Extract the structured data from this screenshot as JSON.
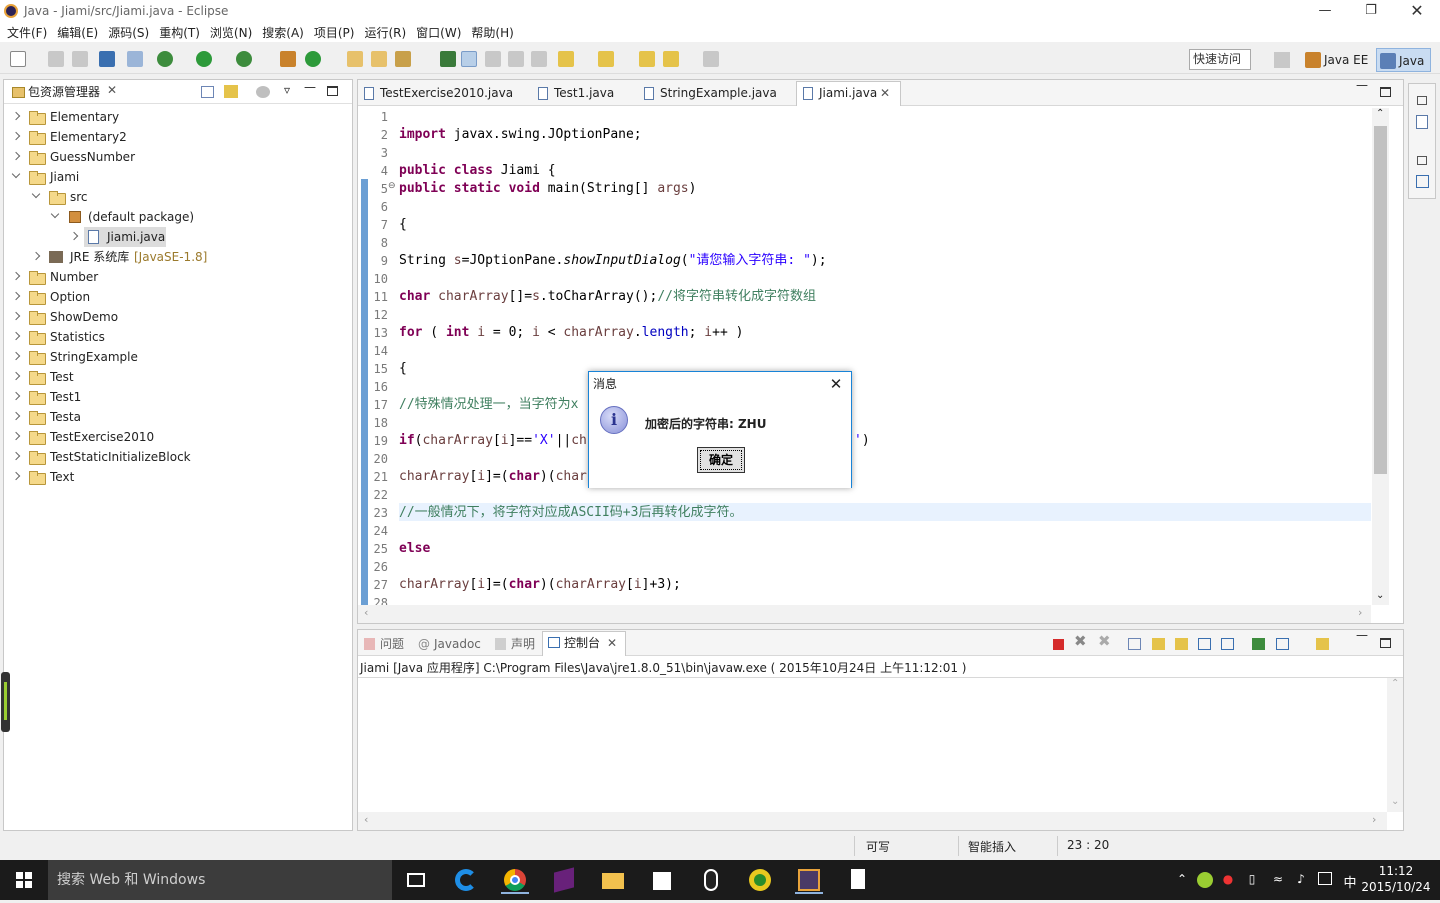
{
  "window": {
    "title": "Java  -  Jiami/src/Jiami.java  -  Eclipse"
  },
  "menu": [
    "文件(F)",
    "编辑(E)",
    "源码(S)",
    "重构(T)",
    "浏览(N)",
    "搜索(A)",
    "项目(P)",
    "运行(R)",
    "窗口(W)",
    "帮助(H)"
  ],
  "toolbar": {
    "quick_access": "快速访问"
  },
  "perspectives": [
    "Java EE",
    "Java"
  ],
  "package_explorer": {
    "title": "包资源管理器",
    "items": [
      {
        "label": "Elementary"
      },
      {
        "label": "Elementary2"
      },
      {
        "label": "GuessNumber"
      },
      {
        "label": "Jiami"
      },
      {
        "label": "src"
      },
      {
        "label": "(default package)"
      },
      {
        "label": "Jiami.java"
      },
      {
        "label": "JRE 系统库",
        "extra": "[JavaSE-1.8]"
      },
      {
        "label": "Number"
      },
      {
        "label": "Option"
      },
      {
        "label": "ShowDemo"
      },
      {
        "label": "Statistics"
      },
      {
        "label": "StringExample"
      },
      {
        "label": "Test"
      },
      {
        "label": "Test1"
      },
      {
        "label": "Testa"
      },
      {
        "label": "TestExercise2010"
      },
      {
        "label": "TestStaticInitializeBlock"
      },
      {
        "label": "Text"
      }
    ]
  },
  "editor": {
    "tabs": [
      "TestExercise2010.java",
      "Test1.java",
      "StringExample.java",
      "Jiami.java"
    ],
    "line_numbers": [
      "1",
      "2",
      "3",
      "4",
      "5",
      "6",
      "7",
      "8",
      "9",
      "10",
      "11",
      "12",
      "13",
      "14",
      "15",
      "16",
      "17",
      "18",
      "19",
      "20",
      "21",
      "22",
      "23",
      "24",
      "25",
      "26",
      "27",
      "28"
    ],
    "code": {
      "l2a": "import",
      "l2b": " javax.swing.JOptionPane;",
      "l4a": "public",
      "l4b": " ",
      "l4c": "class",
      "l4d": " Jiami {",
      "l5a": "public",
      "l5b": " ",
      "l5c": "static",
      "l5d": " ",
      "l5e": "void",
      "l5f": " main(String[] ",
      "l5g": "args",
      "l5h": ")",
      "l7": "{",
      "l9a": "String ",
      "l9b": "s",
      "l9c": "=JOptionPane.",
      "l9d": "showInputDialog",
      "l9e": "(",
      "l9f": "\"请您输入字符串: \"",
      "l9g": ");",
      "l11a": "char",
      "l11b": " ",
      "l11c": "charArray",
      "l11d": "[]=",
      "l11e": "s",
      "l11f": ".toCharArray();",
      "l11g": "//将字符串转化成字符数组",
      "l13a": "for",
      "l13b": " ( ",
      "l13c": "int",
      "l13d": " ",
      "l13e": "i",
      "l13f": " = 0; ",
      "l13g": "i",
      "l13h": " < ",
      "l13i": "charArray",
      "l13j": ".",
      "l13k": "length",
      "l13l": "; ",
      "l13m": "i",
      "l13n": "++ )",
      "l15": "{",
      "l17": "//特殊情况处理一，当字符为x",
      "l19a": "if",
      "l19b": "(",
      "l19c": "charArray",
      "l19d": "[",
      "l19e": "i",
      "l19f": "]==",
      "l19g": "'X'",
      "l19h": "||",
      "l19i": "ch",
      "l19z1": "'",
      "l19z2": ")",
      "l21a": "charArray",
      "l21b": "[",
      "l21c": "i",
      "l21d": "]=(",
      "l21e": "char",
      "l21f": ")(",
      "l21g": "char",
      "l23": "//一般情况下，将字符对应成ASCII码+3后再转化成字符。",
      "l25": "else",
      "l27a": "charArray",
      "l27b": "[",
      "l27c": "i",
      "l27d": "]=(",
      "l27e": "char",
      "l27f": ")(",
      "l27g": "charArray",
      "l27h": "[",
      "l27i": "i",
      "l27j": "]+3);"
    }
  },
  "dialog": {
    "title": "消息",
    "message": "加密后的字符串: ZHU",
    "ok": "确定"
  },
  "console": {
    "tabs": [
      "问题",
      "Javadoc",
      "声明",
      "控制台"
    ],
    "header": "Jiami [Java 应用程序] C:\\Program Files\\Java\\jre1.8.0_51\\bin\\javaw.exe ( 2015年10月24日 上午11:12:01 )"
  },
  "status": {
    "writable": "可写",
    "insert_mode": "智能插入",
    "position": "23 : 20"
  },
  "taskbar": {
    "search_placeholder": "搜索 Web 和 Windows",
    "ime": "中",
    "time": "11:12",
    "date": "2015/10/24"
  }
}
